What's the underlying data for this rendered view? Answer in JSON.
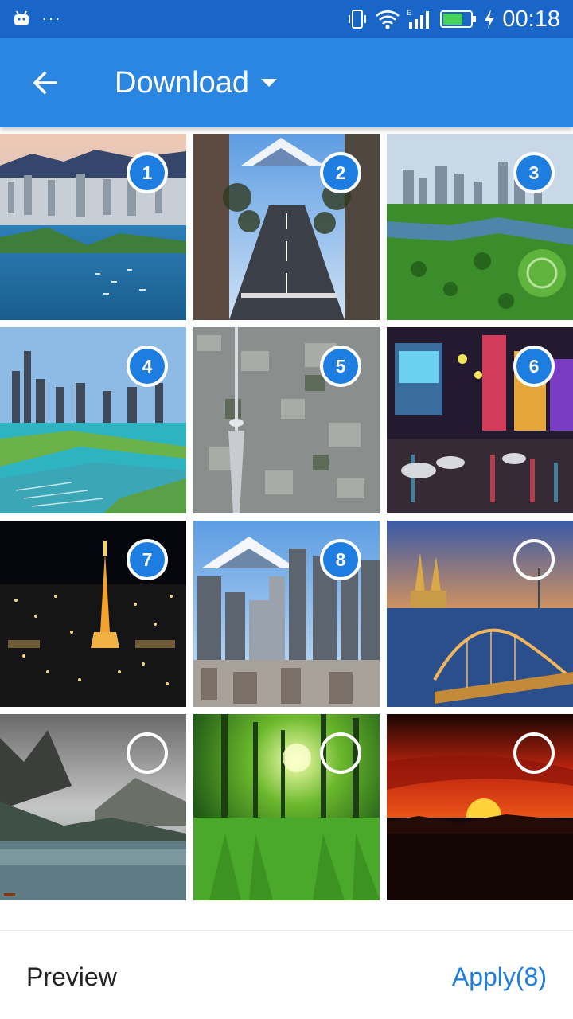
{
  "status_bar": {
    "time": "00:18",
    "notif_dots": "···"
  },
  "app_bar": {
    "title": "Download"
  },
  "grid": {
    "items": [
      {
        "scene": "city-bay",
        "badge": "1",
        "selected": true
      },
      {
        "scene": "street-fuji",
        "badge": "2",
        "selected": true
      },
      {
        "scene": "city-park",
        "badge": "3",
        "selected": true
      },
      {
        "scene": "lakefront-city",
        "badge": "4",
        "selected": true
      },
      {
        "scene": "tower-aerial",
        "badge": "5",
        "selected": true
      },
      {
        "scene": "neon-street",
        "badge": "6",
        "selected": true
      },
      {
        "scene": "night-tower",
        "badge": "7",
        "selected": true
      },
      {
        "scene": "city-fuji",
        "badge": "8",
        "selected": true
      },
      {
        "scene": "cathedral-bridge",
        "badge": "",
        "selected": false
      },
      {
        "scene": "misty-lake",
        "badge": "",
        "selected": false
      },
      {
        "scene": "green-forest",
        "badge": "",
        "selected": false
      },
      {
        "scene": "red-sunset",
        "badge": "",
        "selected": false
      }
    ]
  },
  "bottom_bar": {
    "preview_label": "Preview",
    "apply_label": "Apply(8)"
  },
  "colors": {
    "status_bar": "#1a66c8",
    "app_bar": "#2a86e0",
    "accent": "#1e7de0"
  }
}
